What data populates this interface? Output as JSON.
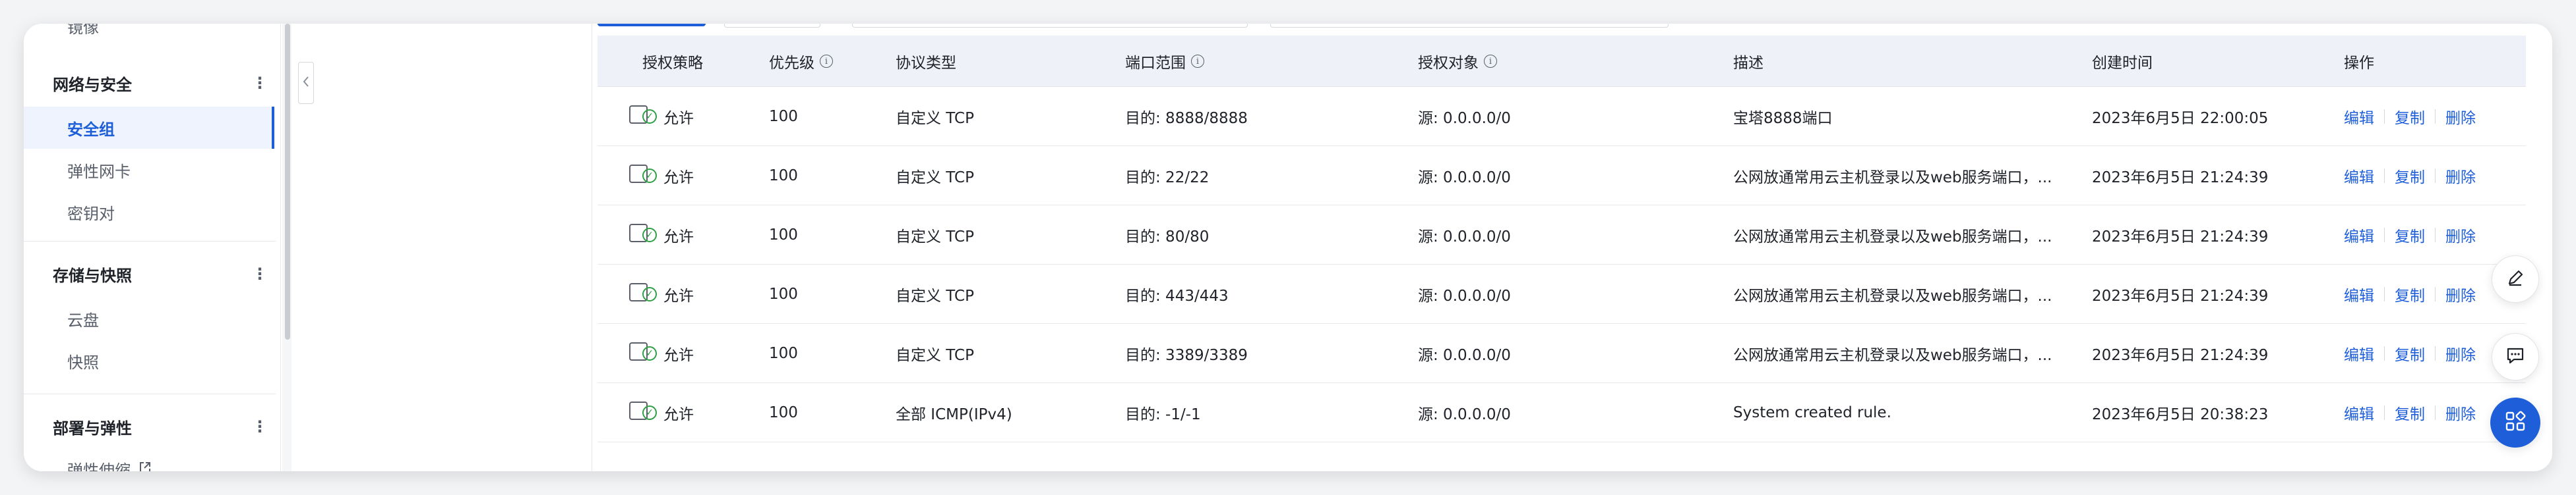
{
  "sidebar": {
    "cut_top_label": "镜像",
    "groups": [
      {
        "title": "网络与安全",
        "items": [
          "安全组",
          "弹性网卡",
          "密钥对"
        ]
      },
      {
        "title": "存储与快照",
        "items": [
          "云盘",
          "快照"
        ]
      },
      {
        "title": "部署与弹性",
        "items": [
          "弹性伸缩"
        ]
      }
    ],
    "active_item": "安全组",
    "kebab": "⋮"
  },
  "table": {
    "headers": {
      "policy": "授权策略",
      "priority": "优先级",
      "protocol": "协议类型",
      "port": "端口范围",
      "target": "授权对象",
      "desc": "描述",
      "created": "创建时间",
      "actions": "操作"
    },
    "rows": [
      {
        "policy": "允许",
        "priority": "100",
        "protocol": "自定义 TCP",
        "port": "目的: 8888/8888",
        "target": "源: 0.0.0.0/0",
        "desc": "宝塔8888端口",
        "created": "2023年6月5日 22:00:05"
      },
      {
        "policy": "允许",
        "priority": "100",
        "protocol": "自定义 TCP",
        "port": "目的: 22/22",
        "target": "源: 0.0.0.0/0",
        "desc": "公网放通常用云主机登录以及web服务端口，...",
        "created": "2023年6月5日 21:24:39"
      },
      {
        "policy": "允许",
        "priority": "100",
        "protocol": "自定义 TCP",
        "port": "目的: 80/80",
        "target": "源: 0.0.0.0/0",
        "desc": "公网放通常用云主机登录以及web服务端口，...",
        "created": "2023年6月5日 21:24:39"
      },
      {
        "policy": "允许",
        "priority": "100",
        "protocol": "自定义 TCP",
        "port": "目的: 443/443",
        "target": "源: 0.0.0.0/0",
        "desc": "公网放通常用云主机登录以及web服务端口，...",
        "created": "2023年6月5日 21:24:39"
      },
      {
        "policy": "允许",
        "priority": "100",
        "protocol": "自定义 TCP",
        "port": "目的: 3389/3389",
        "target": "源: 0.0.0.0/0",
        "desc": "公网放通常用云主机登录以及web服务端口，...",
        "created": "2023年6月5日 21:24:39"
      },
      {
        "policy": "允许",
        "priority": "100",
        "protocol": "全部 ICMP(IPv4)",
        "port": "目的: -1/-1",
        "target": "源: 0.0.0.0/0",
        "desc": "System created rule.",
        "created": "2023年6月5日 20:38:23"
      }
    ],
    "actions": {
      "edit": "编辑",
      "copy": "复制",
      "delete": "删除"
    }
  },
  "colors": {
    "accent": "#1e5fd9",
    "allow_green": "#2ea043",
    "header_bg": "#eef1f8"
  },
  "icons": {
    "collapse": "chevron-left-icon",
    "info": "info-circle-icon",
    "allow": "check-circle-icon",
    "external": "external-link-icon",
    "float_tools": [
      "edit-icon",
      "chat-icon",
      "apps-grid-icon"
    ]
  }
}
